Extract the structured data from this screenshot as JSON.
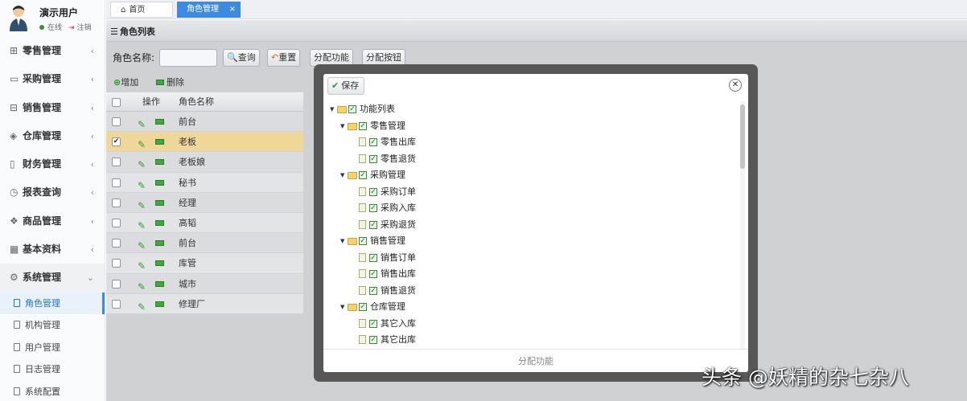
{
  "user": {
    "name": "演示用户",
    "status": "在线",
    "logout": "注销"
  },
  "sidebar": {
    "menus": [
      {
        "label": "零售管理",
        "icon": "gift-icon"
      },
      {
        "label": "采购管理",
        "icon": "monitor-icon"
      },
      {
        "label": "销售管理",
        "icon": "calendar-icon"
      },
      {
        "label": "仓库管理",
        "icon": "layers-icon"
      },
      {
        "label": "财务管理",
        "icon": "book-icon"
      },
      {
        "label": "报表查询",
        "icon": "clock-icon"
      },
      {
        "label": "商品管理",
        "icon": "cube-icon"
      },
      {
        "label": "基本资料",
        "icon": "grid-icon"
      },
      {
        "label": "系统管理",
        "icon": "gear-icon"
      }
    ],
    "submenu": [
      "角色管理",
      "机构管理",
      "用户管理",
      "日志管理",
      "系统配置"
    ]
  },
  "tabs": {
    "home": "首页",
    "role": "角色管理"
  },
  "panel": {
    "title": "角色列表"
  },
  "toolbar": {
    "rolename_label": "角色名称:",
    "query": "查询",
    "reset": "重置",
    "assign_func": "分配功能",
    "assign_btn": "分配按钮",
    "search_value": ""
  },
  "grid_toolbar": {
    "add": "增加",
    "delete": "删除"
  },
  "grid": {
    "headers": {
      "op": "操作",
      "name": "角色名称"
    },
    "rows": [
      "前台",
      "老板",
      "老板娘",
      "秘书",
      "经理",
      "高韬",
      "前台",
      "库管",
      "城市",
      "修理厂"
    ],
    "selected_index": 1
  },
  "dialog": {
    "save": "保存",
    "root": "功能列表",
    "groups": [
      {
        "name": "零售管理",
        "items": [
          "零售出库",
          "零售退货"
        ]
      },
      {
        "name": "采购管理",
        "items": [
          "采购订单",
          "采购入库",
          "采购退货"
        ]
      },
      {
        "name": "销售管理",
        "items": [
          "销售订单",
          "销售出库",
          "销售退货"
        ]
      },
      {
        "name": "仓库管理",
        "items": [
          "其它入库",
          "其它出库"
        ]
      }
    ],
    "footer": "分配功能"
  },
  "watermark": "头条 @妖精的杂七杂八",
  "colors": {
    "accent": "#3d8be0",
    "selected_row": "#efd79a",
    "dialog_frame": "#575757"
  }
}
